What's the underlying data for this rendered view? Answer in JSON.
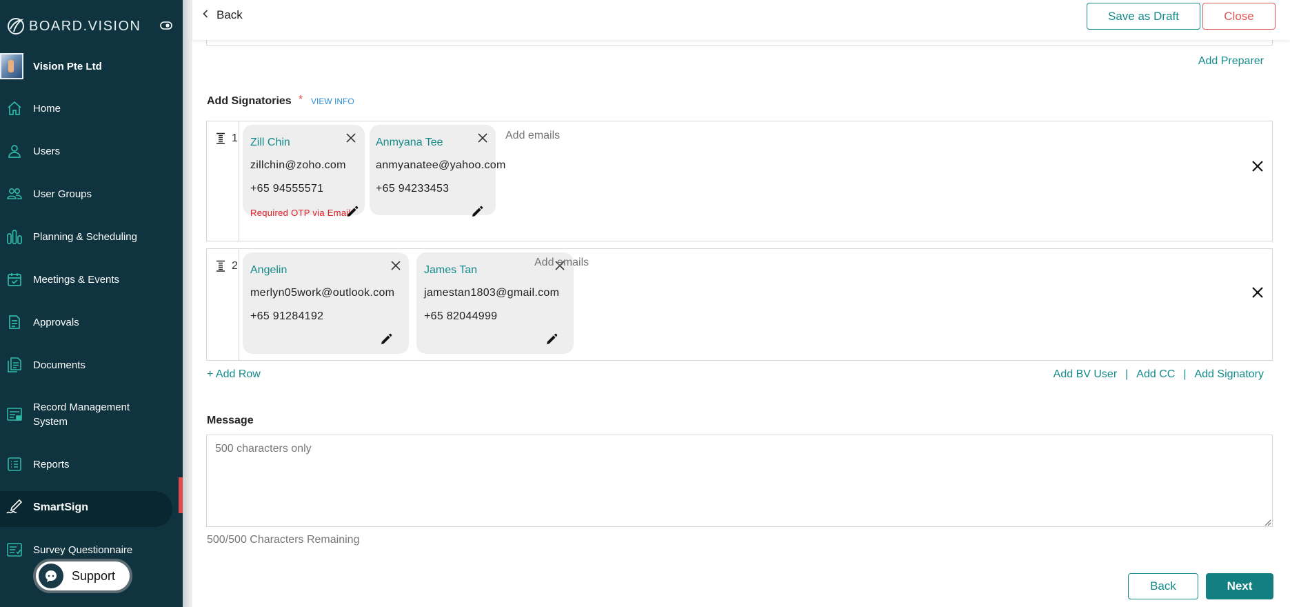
{
  "sidebar": {
    "logo_text": "BOARD.VISION",
    "org_name": "Vision Pte Ltd",
    "items": [
      {
        "label": "Home",
        "icon": "home-icon"
      },
      {
        "label": "Users",
        "icon": "user-icon"
      },
      {
        "label": "User Groups",
        "icon": "user-groups-icon"
      },
      {
        "label": "Planning & Scheduling",
        "icon": "bar-chart-icon"
      },
      {
        "label": "Meetings & Events",
        "icon": "calendar-check-icon"
      },
      {
        "label": "Approvals",
        "icon": "approvals-document-icon"
      },
      {
        "label": "Documents",
        "icon": "documents-icon"
      },
      {
        "label": "Record Management System",
        "icon": "record-management-icon"
      },
      {
        "label": "Reports",
        "icon": "reports-list-icon"
      },
      {
        "label": "SmartSign",
        "icon": "signature-pen-icon",
        "active": true
      },
      {
        "label": "Survey Questionnaire",
        "icon": "survey-checklist-icon"
      }
    ],
    "support_label": "Support",
    "colors": {
      "background": "#0f3440",
      "accent": "#2fb9a8",
      "active_marker": "#e24b4b"
    }
  },
  "header": {
    "back_label": "Back",
    "save_draft_label": "Save as Draft",
    "close_label": "Close"
  },
  "preparer": {
    "add_preparer_label": "Add Preparer"
  },
  "signatories": {
    "title": "Add Signatories",
    "required_mark": "*",
    "view_info_label": "VIEW INFO",
    "add_emails_placeholder": "Add emails",
    "rows": [
      {
        "number": "1",
        "cards": [
          {
            "name": "Zill Chin",
            "email": "zillchin@zoho.com",
            "phone": "+65 94555571",
            "note": "Required OTP via Email"
          },
          {
            "name": "Anmyana Tee",
            "email": "anmyanatee@yahoo.com",
            "phone": "+65 94233453",
            "note": ""
          }
        ]
      },
      {
        "number": "2",
        "cards": [
          {
            "name": "Angelin",
            "email": "merlyn05work@outlook.com",
            "phone": "+65 91284192",
            "note": ""
          },
          {
            "name": "James Tan",
            "email": "jamestan1803@gmail.com",
            "phone": "+65 82044999",
            "note": ""
          }
        ]
      }
    ],
    "add_row_label": "+ Add Row",
    "add_bv_user_label": "Add BV User",
    "add_cc_label": "Add CC",
    "add_signatory_label": "Add Signatory",
    "separator": "|"
  },
  "message": {
    "label": "Message",
    "placeholder": "500 characters only",
    "remaining": "500/500 Characters Remaining"
  },
  "footer": {
    "back_label": "Back",
    "next_label": "Next"
  },
  "colors": {
    "teal": "#148a8a",
    "danger": "#e05757",
    "otp_red": "#e01b24"
  }
}
